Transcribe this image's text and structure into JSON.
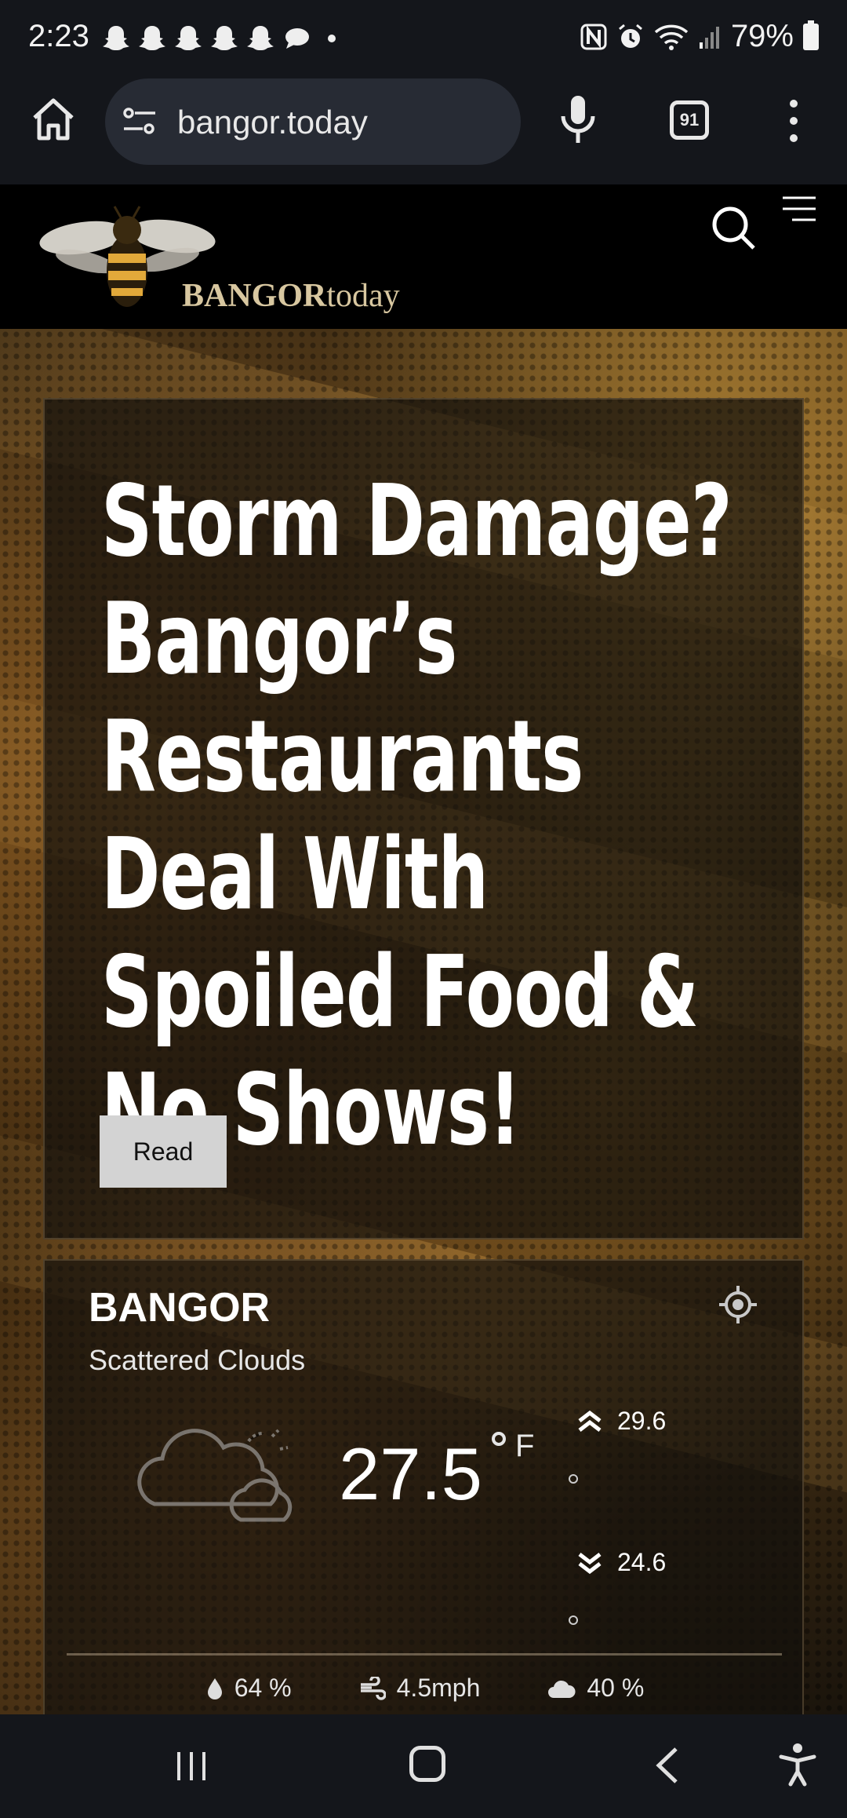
{
  "status_bar": {
    "time": "2:23",
    "battery": "79%",
    "icons": [
      "snapchat-icon",
      "snapchat-icon",
      "snapchat-icon",
      "snapchat-icon",
      "snapchat-icon",
      "chat-icon",
      "dot-icon",
      "nfc-icon",
      "alarm-icon",
      "wifi-icon",
      "signal-icon",
      "battery-icon"
    ]
  },
  "browser": {
    "url": "bangor.today",
    "tab_count": "91",
    "icons": [
      "home-icon",
      "site-settings-icon",
      "mic-icon",
      "tabs-icon",
      "more-icon"
    ]
  },
  "site": {
    "logo_main": "BANGOR",
    "logo_suffix": "today",
    "icons": [
      "bee-logo-icon",
      "search-icon",
      "menu-icon"
    ]
  },
  "story": {
    "title": "Storm Damage? Bangor’s Restaurants Deal With Spoiled Food & No Shows!",
    "read_label": "Read"
  },
  "weather": {
    "city": "BANGOR",
    "description": "Scattered Clouds",
    "temperature": "27.5",
    "unit": "F",
    "high": "29.6",
    "low": "24.6",
    "humidity": "64 %",
    "wind": "4.5mph",
    "cloudiness": "40 %",
    "icons": [
      "locate-icon",
      "cloud-icon",
      "high-arrow-icon",
      "low-arrow-icon",
      "humidity-icon",
      "wind-icon",
      "cloud-small-icon"
    ]
  },
  "nav_bar": {
    "icons": [
      "recents-icon",
      "home-button-icon",
      "back-icon",
      "accessibility-icon"
    ]
  }
}
